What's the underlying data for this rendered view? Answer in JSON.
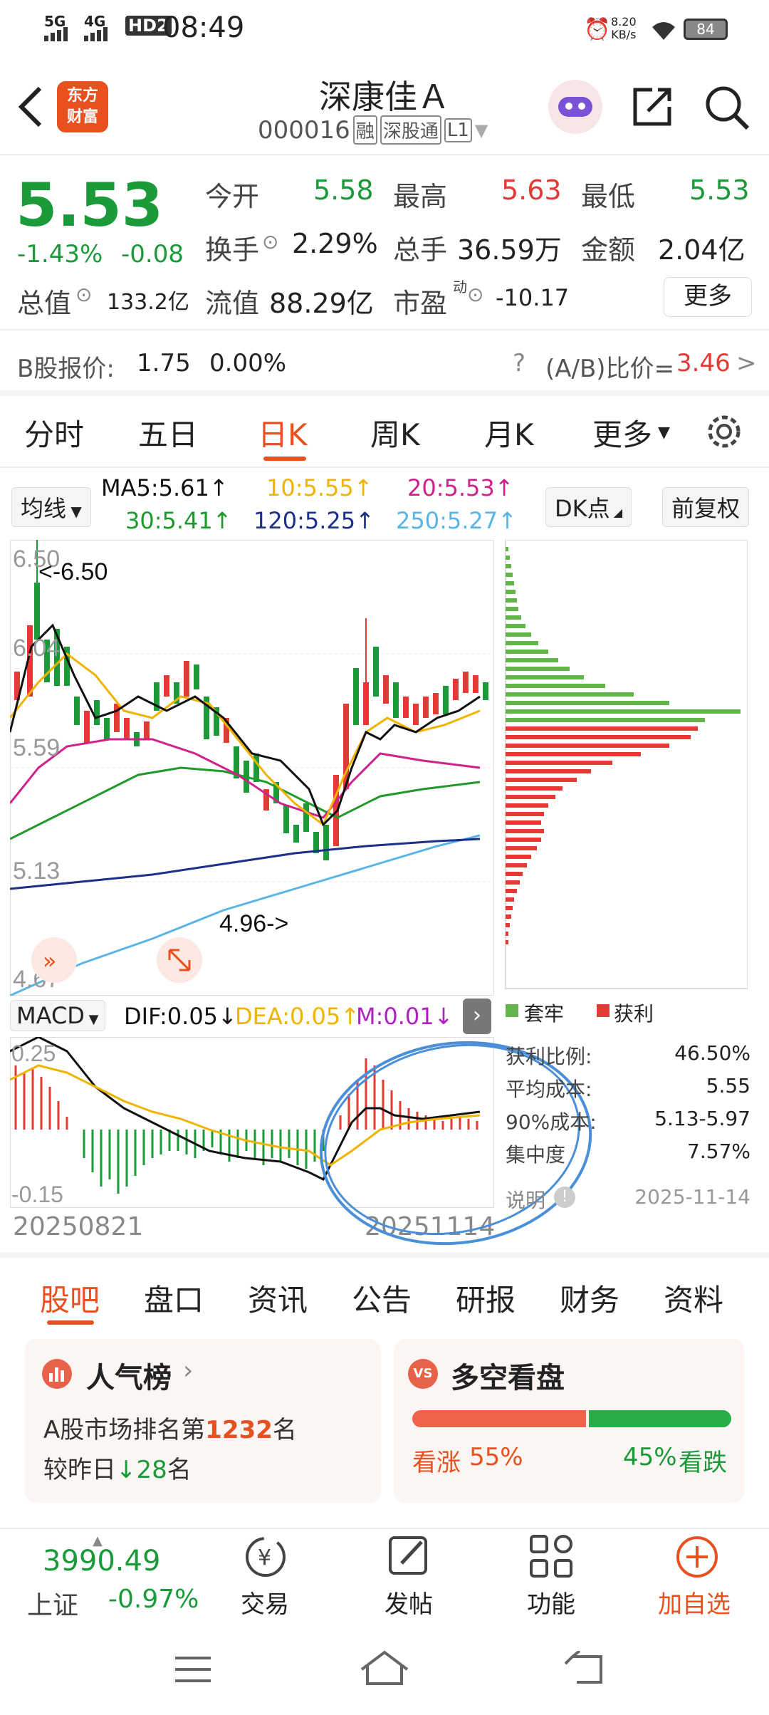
{
  "status": {
    "signal1": "5G",
    "signal2": "4G",
    "hd": "HD2",
    "time": "08:49",
    "speed": "8.20\nKB/s",
    "battery": "84"
  },
  "nav": {
    "logo": "东方\n财富",
    "title": "深康佳Ａ",
    "code": "000016",
    "tag_rong": "融",
    "tag_sgt": "深股通",
    "tag_l1": "L1"
  },
  "quote": {
    "price": "5.53",
    "change_pct": "-1.43%",
    "change": "-0.08",
    "open_label": "今开",
    "open": "5.58",
    "high_label": "最高",
    "high": "5.63",
    "low_label": "最低",
    "low": "5.53",
    "turnover_label": "换手",
    "turnover": "2.29%",
    "volume_label": "总手",
    "volume": "36.59万",
    "amount_label": "金额",
    "amount": "2.04亿",
    "mcap_label": "总值",
    "mcap": "133.2亿",
    "float_label": "流值",
    "float": "88.29亿",
    "pe_label": "市盈",
    "pe_sup": "动",
    "pe": "-10.17",
    "more": "更多"
  },
  "bshare": {
    "label": "B股报价:",
    "price": "1.75",
    "pct": "0.00%",
    "ratio_label": "(A/B)比价=",
    "ratio": "3.46",
    "arrow": ">"
  },
  "tabs": {
    "t1": "分时",
    "t2": "五日",
    "t3": "日K",
    "t4": "周K",
    "t5": "月K",
    "t6": "更多"
  },
  "ma": {
    "btn": "均线",
    "ma5": "MA5:5.61↑",
    "ma10": "10:5.55↑",
    "ma20": "20:5.53↑",
    "ma30": "30:5.41↑",
    "ma120": "120:5.25↑",
    "ma250": "250:5.27↑",
    "dk": "DK点",
    "fq": "前复权"
  },
  "chart_labels": {
    "y1": "6.50",
    "y2": "6.04",
    "y3": "5.59",
    "y4": "5.13",
    "y5": "4.67",
    "hi_ann": "<-6.50",
    "lo_ann": "4.96->"
  },
  "macd": {
    "btn": "MACD",
    "dif": "DIF:0.05↓",
    "dea": "DEA:0.05↑",
    "m": "M:0.01↓",
    "y_top": "0.25",
    "y_bottom": "-0.15",
    "date_start": "20250821",
    "date_end": "20251114"
  },
  "dist": {
    "legend_trap": "套牢",
    "legend_profit": "获利",
    "profit_ratio_label": "获利比例:",
    "profit_ratio": "46.50%",
    "avg_cost_label": "平均成本:",
    "avg_cost": "5.55",
    "cost90_label": "90%成本:",
    "cost90": "5.13-5.97",
    "concentration_label": "集中度",
    "concentration": "7.57%",
    "note": "说明",
    "date": "2025-11-14"
  },
  "subtabs": {
    "s1": "股吧",
    "s2": "盘口",
    "s3": "资讯",
    "s4": "公告",
    "s5": "研报",
    "s6": "财务",
    "s7": "资料"
  },
  "cards": {
    "pop_title": "人气榜",
    "pop_line1a": "A股市场排名第",
    "pop_rank": "1232",
    "pop_line1b": "名",
    "pop_line2a": "较昨日",
    "pop_change": "28",
    "pop_line2b": "名",
    "ls_title": "多空看盘",
    "bull_label": "看涨",
    "bull_pct": "55%",
    "bear_pct": "45%",
    "bear_label": "看跌"
  },
  "bottom": {
    "index_value": "3990.49",
    "index_name": "上证",
    "index_change": "-0.97%",
    "trade": "交易",
    "post": "发帖",
    "func": "功能",
    "add": "加自选"
  },
  "colors": {
    "up": "#e53935",
    "down": "#1b9a3a",
    "accent": "#e8501f",
    "ma5": "#111111",
    "ma10": "#f0b400",
    "ma20": "#d0208a",
    "ma30": "#1f9a2a",
    "ma120": "#1c2f8c",
    "ma250": "#5ab4e6"
  }
}
